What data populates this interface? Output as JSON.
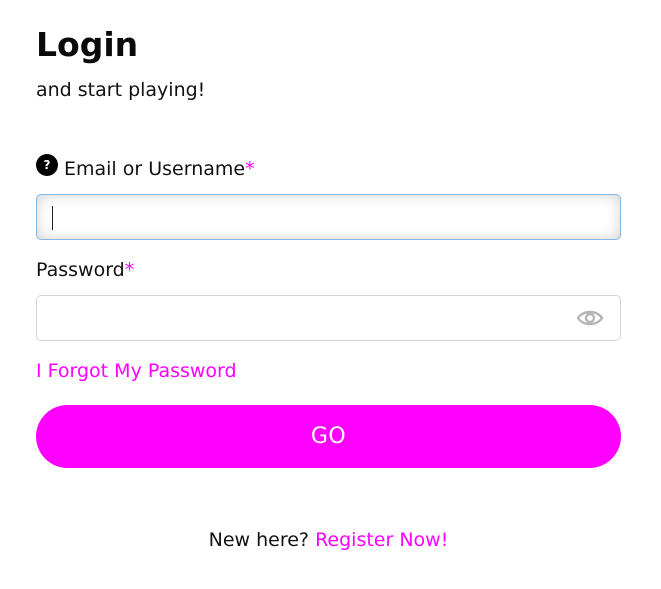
{
  "header": {
    "title": "Login",
    "subtitle": "and start playing!"
  },
  "email_field": {
    "label": "Email or Username",
    "required_mark": "*",
    "value": "",
    "placeholder": "",
    "help_icon_glyph": "?",
    "icon": "help-icon"
  },
  "password_field": {
    "label": "Password",
    "required_mark": "*",
    "value": "",
    "placeholder": "",
    "icon": "eye-icon"
  },
  "links": {
    "forgot_password": "I Forgot My Password"
  },
  "submit": {
    "label": "GO"
  },
  "register": {
    "prompt": "New here?",
    "link": "Register Now!"
  },
  "colors": {
    "accent": "#ff00ff",
    "text": "#111111",
    "focus_border": "#86b7e8",
    "border": "#d6d6d6",
    "icon_gray": "#b5b5b5"
  }
}
